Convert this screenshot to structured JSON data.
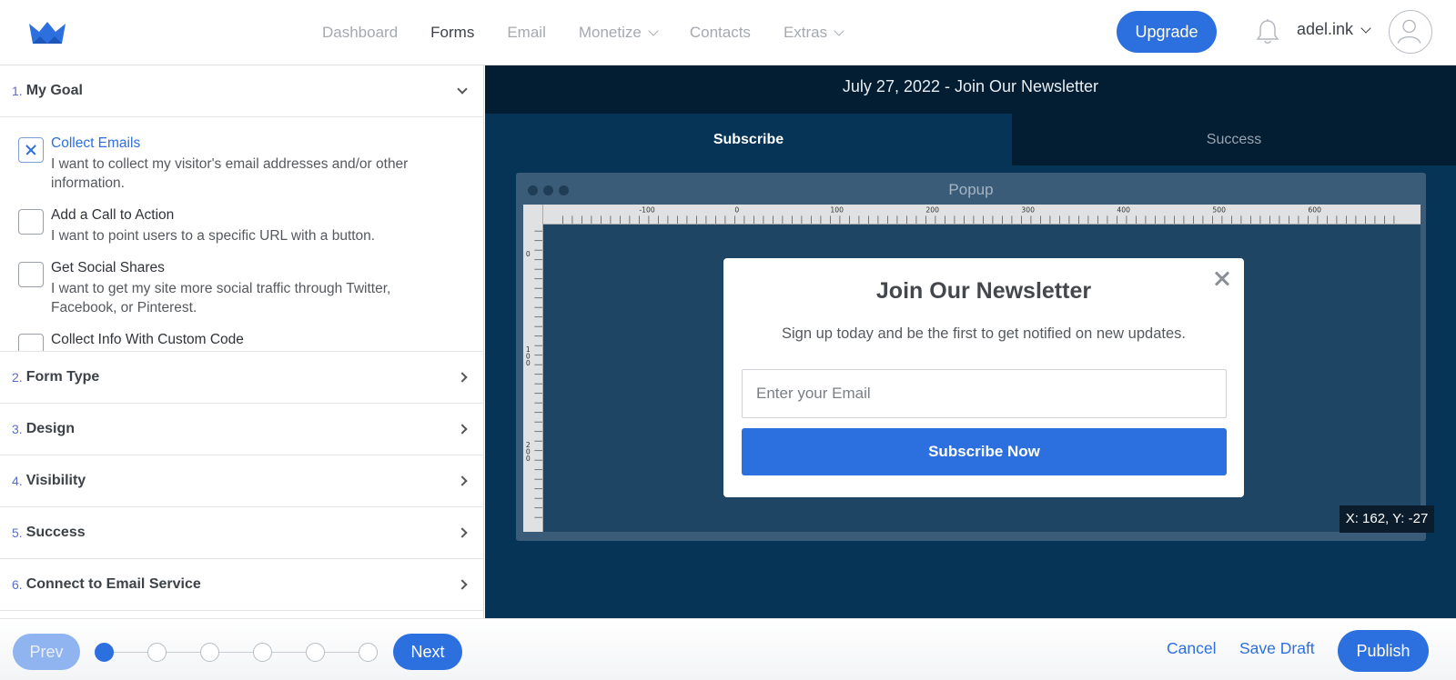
{
  "nav": {
    "items": [
      {
        "label": "Dashboard",
        "active": false,
        "dropdown": false
      },
      {
        "label": "Forms",
        "active": true,
        "dropdown": false
      },
      {
        "label": "Email",
        "active": false,
        "dropdown": false
      },
      {
        "label": "Monetize",
        "active": false,
        "dropdown": true
      },
      {
        "label": "Contacts",
        "active": false,
        "dropdown": false
      },
      {
        "label": "Extras",
        "active": false,
        "dropdown": true
      }
    ],
    "upgrade_label": "Upgrade",
    "account_name": "adel.ink",
    "icons": {
      "logo": "crown-logo",
      "bell": "bell-icon",
      "avatar": "user-avatar-icon"
    }
  },
  "sidebar": {
    "sections": [
      {
        "num": "1.",
        "title": "My Goal",
        "expanded": true
      },
      {
        "num": "2.",
        "title": "Form Type",
        "expanded": false
      },
      {
        "num": "3.",
        "title": "Design",
        "expanded": false
      },
      {
        "num": "4.",
        "title": "Visibility",
        "expanded": false
      },
      {
        "num": "5.",
        "title": "Success",
        "expanded": false
      },
      {
        "num": "6.",
        "title": "Connect to Email Service",
        "expanded": false
      }
    ],
    "goals": [
      {
        "title": "Collect Emails",
        "desc": "I want to collect my visitor's email addresses and/or other information.",
        "checked": true
      },
      {
        "title": "Add a Call to Action",
        "desc": "I want to point users to a specific URL with a button.",
        "checked": false
      },
      {
        "title": "Get Social Shares",
        "desc": "I want to get my site more social traffic through Twitter, Facebook, or Pinterest.",
        "checked": false
      },
      {
        "title": "Collect Info With Custom Code",
        "desc": "",
        "checked": false
      }
    ]
  },
  "preview": {
    "title": "July 27, 2022 - Join Our Newsletter",
    "tabs": [
      {
        "label": "Subscribe",
        "active": true
      },
      {
        "label": "Success",
        "active": false
      }
    ],
    "device_title": "Popup",
    "ruler_top_labels": [
      "-100",
      "0",
      "100",
      "200",
      "300",
      "400",
      "500",
      "600"
    ],
    "ruler_left_labels": [
      "0",
      "1\n0\n0",
      "2\n0\n0"
    ],
    "coords": "X: 162, Y: -27"
  },
  "popup": {
    "title": "Join Our Newsletter",
    "subtitle": "Sign up today and be the first to get notified on new updates.",
    "email_placeholder": "Enter your Email",
    "email_value": "",
    "button_label": "Subscribe Now"
  },
  "footer": {
    "prev_label": "Prev",
    "next_label": "Next",
    "steps_total": 6,
    "current_step": 1,
    "cancel_label": "Cancel",
    "save_draft_label": "Save Draft",
    "publish_label": "Publish"
  },
  "colors": {
    "accent": "#2c6fdf",
    "preview_bg": "#063456",
    "preview_dark": "#031d33"
  }
}
